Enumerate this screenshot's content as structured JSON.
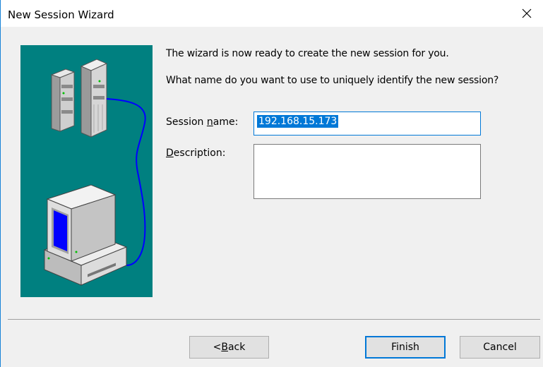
{
  "window": {
    "title": "New Session Wizard"
  },
  "wizard": {
    "intro": "The wizard is now ready to create the new session for you.",
    "question": "What name do you want to use to uniquely identify the new session?"
  },
  "form": {
    "session_name_label_pre": "Session ",
    "session_name_label_mnemonic": "n",
    "session_name_label_post": "ame:",
    "session_name_value": "192.168.15.173",
    "description_label_mnemonic": "D",
    "description_label_post": "escription:",
    "description_value": ""
  },
  "buttons": {
    "back_pre": "< ",
    "back_mnemonic": "B",
    "back_post": "ack",
    "finish": "Finish",
    "cancel": "Cancel"
  },
  "colors": {
    "accent": "#0078d7",
    "illustration_bg": "#008080",
    "monitor_screen": "#0000ff",
    "cable": "#0000ff"
  },
  "icons": [
    "close-icon",
    "server-tower-icon",
    "computer-icon",
    "network-cable-icon"
  ]
}
